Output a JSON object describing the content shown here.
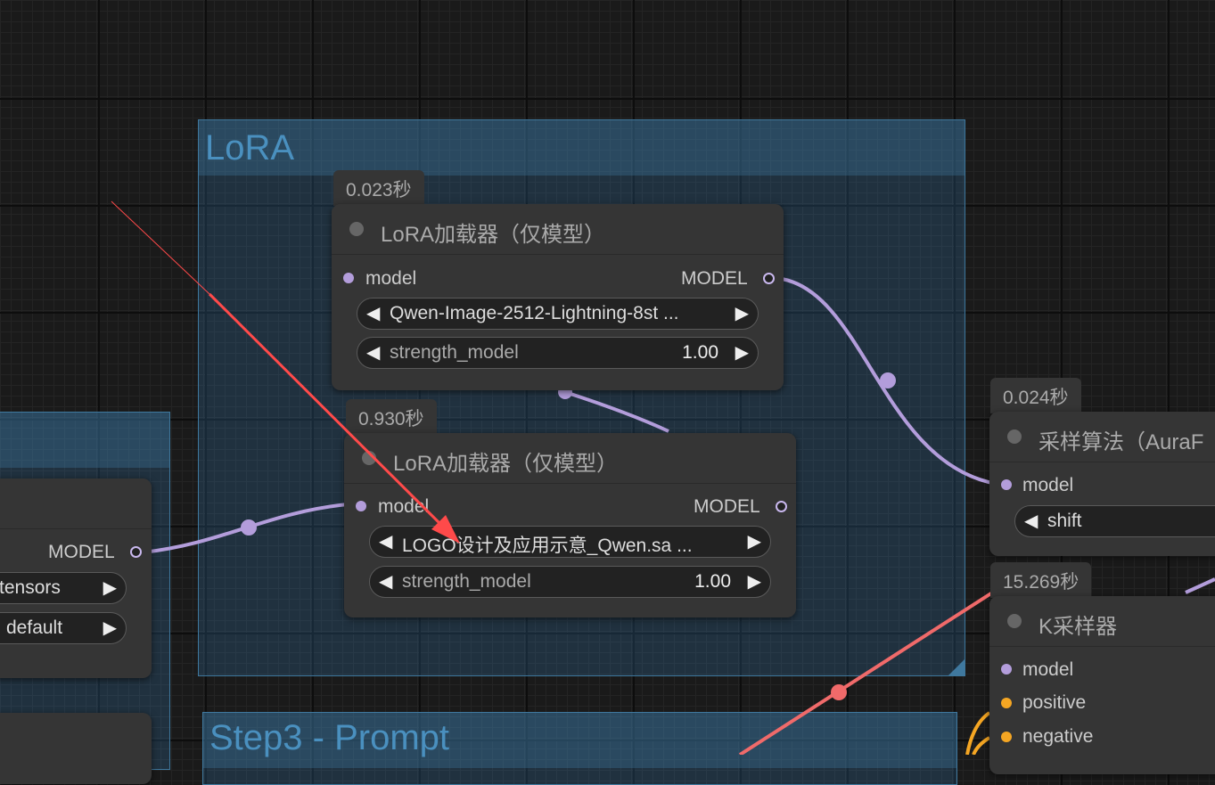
{
  "groups": {
    "lora": {
      "title": "LoRA"
    },
    "step3": {
      "title": "Step3 - Prompt"
    }
  },
  "nodes": {
    "lora1": {
      "timer": "0.023秒",
      "title": "LoRA加载器（仅模型）",
      "input": "model",
      "output": "MODEL",
      "lora_name": "Qwen-Image-2512-Lightning-8st ...",
      "strength_label": "strength_model",
      "strength_value": "1.00"
    },
    "lora2": {
      "timer": "0.930秒",
      "title": "LoRA加载器（仅模型）",
      "input": "model",
      "output": "MODEL",
      "lora_name": "LOGO设计及应用示意_Qwen.sa ...",
      "strength_label": "strength_model",
      "strength_value": "1.00"
    },
    "loader": {
      "output": "MODEL",
      "widget1": "tensors",
      "widget2": "default"
    },
    "sampling": {
      "timer": "0.024秒",
      "title": "采样算法（AuraF",
      "input": "model",
      "shift_label": "shift"
    },
    "ksampler": {
      "timer": "15.269秒",
      "title": "K采样器",
      "inputs": [
        "model",
        "positive",
        "negative"
      ]
    }
  },
  "colors": {
    "model_wire": "#b39ddb",
    "highlight_wire": "#f06a6a",
    "conditioning_wire": "#f5a623",
    "annotation_arrow": "#ff4a4a"
  }
}
